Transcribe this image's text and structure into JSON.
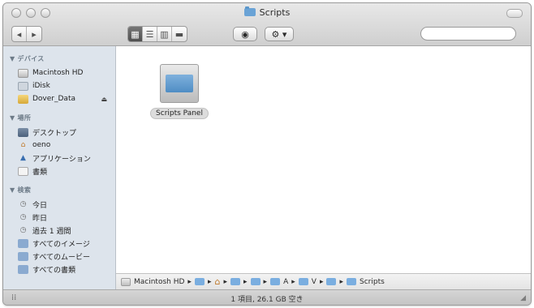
{
  "window": {
    "title": "Scripts",
    "title_icon": "folder-icon"
  },
  "toolbar": {
    "back_icon": "chevron-left-icon",
    "forward_icon": "chevron-right-icon",
    "view_icons": [
      "icon-view-icon",
      "list-view-icon",
      "column-view-icon",
      "cover-flow-icon"
    ],
    "quicklook_icon": "eye-icon",
    "action_icon": "gear-icon",
    "search_placeholder": "",
    "search_icon": "magnifier-icon"
  },
  "sidebar": {
    "sections": [
      {
        "header": "▼ デバイス",
        "items": [
          {
            "label": "Macintosh HD",
            "icon": "hard-disk-icon"
          },
          {
            "label": "iDisk",
            "icon": "idisk-icon"
          },
          {
            "label": "Dover_Data",
            "icon": "external-disk-icon",
            "eject": "⏏"
          }
        ]
      },
      {
        "header": "▼ 場所",
        "items": [
          {
            "label": "デスクトップ",
            "icon": "desktop-icon"
          },
          {
            "label": "oeno",
            "icon": "home-icon"
          },
          {
            "label": "アプリケーション",
            "icon": "applications-icon"
          },
          {
            "label": "書類",
            "icon": "documents-icon"
          }
        ]
      },
      {
        "header": "▼ 検索",
        "items": [
          {
            "label": "今日",
            "icon": "clock-icon"
          },
          {
            "label": "昨日",
            "icon": "clock-icon"
          },
          {
            "label": "過去 1 週間",
            "icon": "clock-icon"
          },
          {
            "label": "すべてのイメージ",
            "icon": "smart-folder-icon"
          },
          {
            "label": "すべてのムービー",
            "icon": "smart-folder-icon"
          },
          {
            "label": "すべての書類",
            "icon": "smart-folder-icon"
          }
        ]
      }
    ]
  },
  "content": {
    "items": [
      {
        "label": "Scripts Panel",
        "icon": "folder-icon"
      }
    ]
  },
  "pathbar": {
    "segments": [
      "Macintosh HD",
      "",
      "",
      "",
      "",
      "",
      "A",
      "V",
      "",
      "Scripts"
    ],
    "separator": "▸"
  },
  "status": {
    "text": "1 項目, 26.1 GB 空き"
  },
  "colors": {
    "sidebar_bg": "#dde4ec",
    "folder_blue": "#5b97cb",
    "window_bg": "#ececec"
  }
}
